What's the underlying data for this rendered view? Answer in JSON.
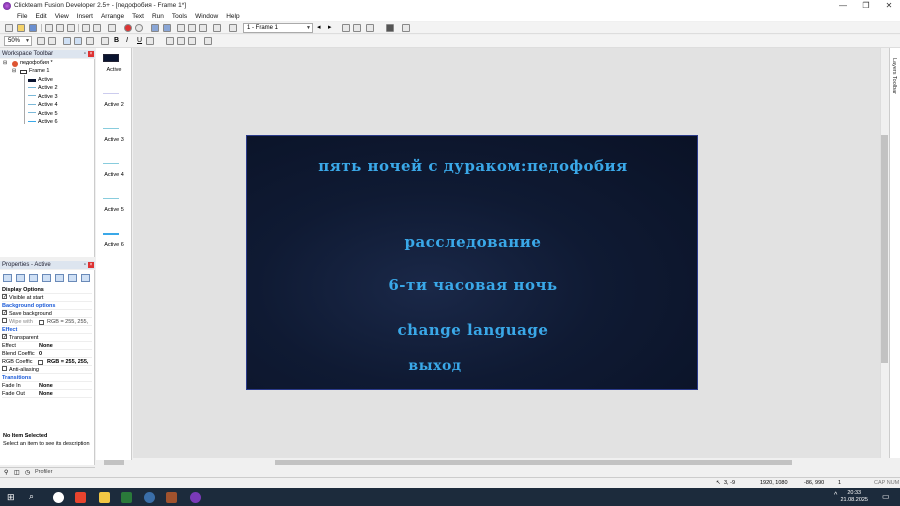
{
  "window": {
    "title": "Clickteam Fusion Developer 2.5+ - [педофобия - Frame 1*]",
    "minimize": "—",
    "restore": "❐",
    "close": "✕"
  },
  "menu": [
    "File",
    "Edit",
    "View",
    "Insert",
    "Arrange",
    "Text",
    "Run",
    "Tools",
    "Window",
    "Help"
  ],
  "toolbar": {
    "frame_combo": "1 - Frame 1",
    "zoom_combo": "50%",
    "bold": "B",
    "italic": "I",
    "underline": "U"
  },
  "workspace": {
    "title": "Workspace Toolbar",
    "app_name": "педофобия *",
    "frame": "Frame 1",
    "objects": [
      "Active",
      "Active 2",
      "Active 3",
      "Active 4",
      "Active 5",
      "Active 6"
    ]
  },
  "properties": {
    "title": "Properties - Active",
    "rows": [
      {
        "type": "group",
        "label": "Display Options"
      },
      {
        "type": "check",
        "label": "Visible at start",
        "checked": true
      },
      {
        "type": "section",
        "label": "Background options"
      },
      {
        "type": "check",
        "label": "Save background",
        "checked": true
      },
      {
        "type": "check2",
        "label": "Wipe with",
        "checked": false,
        "value": "RGB = 255, 255,"
      },
      {
        "type": "section",
        "label": "Effect"
      },
      {
        "type": "check",
        "label": "Transparent",
        "checked": true
      },
      {
        "type": "kv",
        "label": "Effect",
        "value": "None"
      },
      {
        "type": "kv",
        "label": "Blend Coeffic",
        "value": "0"
      },
      {
        "type": "kv",
        "label": "RGB Coeffic",
        "value": "RGB = 255, 255,"
      },
      {
        "type": "check",
        "label": "Anti-aliasing",
        "checked": false
      },
      {
        "type": "section",
        "label": "Transitions"
      },
      {
        "type": "kv",
        "label": "Fade In",
        "value": "None"
      },
      {
        "type": "kv",
        "label": "Fade Out",
        "value": "None"
      }
    ],
    "info_title": "No Item Selected",
    "info_desc": "Select an item to see its description",
    "profiler_tab": "Profiler"
  },
  "objects_column": [
    "Active",
    "Active 2",
    "Active 3",
    "Active 4",
    "Active 5",
    "Active 6"
  ],
  "frame_menu": {
    "title": "пять ночей с дураком:педофобия",
    "items": [
      "расследование",
      "6-ти часовая ночь",
      "change language",
      "выход"
    ]
  },
  "right_strip": "Layers Toolbar",
  "status": {
    "coords": "3, -9",
    "resolution": "1920, 1080",
    "cursor": "-86, 990",
    "layer": "1",
    "mode": "CAP NUM"
  },
  "taskbar": {
    "time": "20:33",
    "date": "21.08.2025"
  },
  "colors": {
    "menu_text": "#3aa8e8",
    "frame_bg": "#0f1a33",
    "section_blue": "#1a5ad8"
  }
}
